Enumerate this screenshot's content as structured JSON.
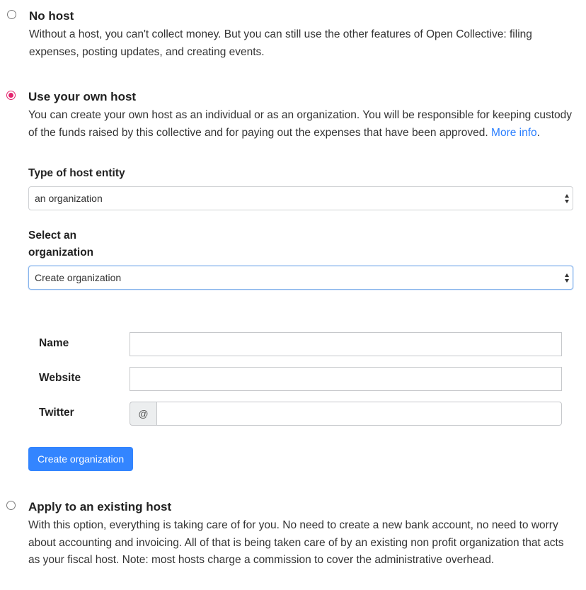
{
  "options": {
    "no_host": {
      "title": "No host",
      "description": "Without a host, you can't collect money. But you can still use the other features of Open Collective: filing expenses, posting updates, and creating events.",
      "selected": false
    },
    "own_host": {
      "title": "Use your own host",
      "description": "You can create your own host as an individual or as an organization. You will be responsible for keeping custody of the funds raised by this collective and for paying out the expenses that have been approved.",
      "more_info_link": "More info",
      "after_link": ".",
      "selected": true
    },
    "existing_host": {
      "title": "Apply to an existing host",
      "description": "With this option, everything is taking care of for you. No need to create a new bank account, no need to worry about accounting and invoicing. All of that is being taken care of by an existing non profit organization that acts as your fiscal host. Note: most hosts charge a commission to cover the administrative overhead.",
      "selected": false
    }
  },
  "host_entity": {
    "label": "Type of host entity",
    "selected": "an organization"
  },
  "organization_select": {
    "label": "Select an organization",
    "selected": "Create organization"
  },
  "form": {
    "name_label": "Name",
    "name_value": "",
    "website_label": "Website",
    "website_value": "",
    "twitter_label": "Twitter",
    "twitter_prefix": "@",
    "twitter_value": "",
    "submit_label": "Create organization"
  },
  "colors": {
    "accent_radio": "#e3226c",
    "link": "#297eff",
    "primary_button": "#3385ff"
  }
}
